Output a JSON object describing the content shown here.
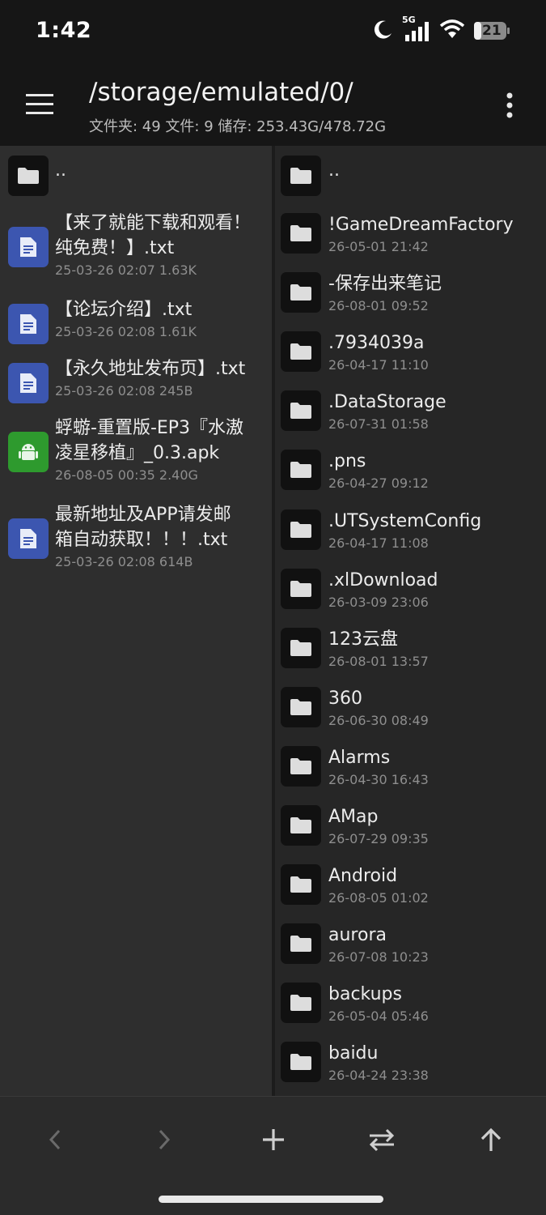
{
  "status": {
    "time": "1:42",
    "network": "5G",
    "battery": "21",
    "icons": [
      "moon-icon",
      "signal-icon",
      "wifi-icon",
      "battery-icon"
    ]
  },
  "appbar": {
    "path": "/storage/emulated/0/",
    "stats": "文件夹: 49  文件: 9  储存: 253.43G/478.72G"
  },
  "left_pane": {
    "parent": "..",
    "items": [
      {
        "type": "doc",
        "name_lines": [
          "【来了就能下载和观看！",
          "纯免费！】.txt"
        ],
        "meta": "25-03-26 02:07  1.63K"
      },
      {
        "type": "doc",
        "name_lines": [
          "【论坛介绍】.txt"
        ],
        "meta": "25-03-26 02:08  1.61K"
      },
      {
        "type": "doc",
        "name_lines": [
          "【永久地址发布页】.txt"
        ],
        "meta": "25-03-26 02:08  245B"
      },
      {
        "type": "apk",
        "name_lines": [
          "蜉蝣-重置版-EP3『水滶",
          "凌星移植』_0.3.apk"
        ],
        "meta": "26-08-05 00:35  2.40G"
      },
      {
        "type": "doc",
        "name_lines": [
          "最新地址及APP请发邮",
          "箱自动获取！！！.txt"
        ],
        "meta": "25-03-26 02:08  614B"
      }
    ]
  },
  "right_pane": {
    "parent": "..",
    "folders": [
      {
        "name": "!GameDreamFactory",
        "date": "26-05-01 21:42"
      },
      {
        "name": "-保存出来笔记",
        "date": "26-08-01 09:52"
      },
      {
        "name": ".7934039a",
        "date": "26-04-17 11:10"
      },
      {
        "name": ".DataStorage",
        "date": "26-07-31 01:58"
      },
      {
        "name": ".pns",
        "date": "26-04-27 09:12"
      },
      {
        "name": ".UTSystemConfig",
        "date": "26-04-17 11:08"
      },
      {
        "name": ".xlDownload",
        "date": "26-03-09 23:06"
      },
      {
        "name": "123云盘",
        "date": "26-08-01 13:57"
      },
      {
        "name": "360",
        "date": "26-06-30 08:49"
      },
      {
        "name": "Alarms",
        "date": "26-04-30 16:43"
      },
      {
        "name": "AMap",
        "date": "26-07-29 09:35"
      },
      {
        "name": "Android",
        "date": "26-08-05 01:02"
      },
      {
        "name": "aurora",
        "date": "26-07-08 10:23"
      },
      {
        "name": "backups",
        "date": "26-05-04 05:46"
      },
      {
        "name": "baidu",
        "date": "26-04-24 23:38"
      }
    ]
  },
  "bottombar": {
    "buttons": [
      "back-icon",
      "forward-icon",
      "add-icon",
      "swap-icon",
      "up-icon"
    ]
  }
}
